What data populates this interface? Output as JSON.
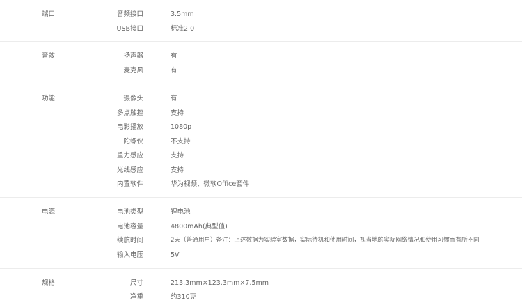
{
  "sections": [
    {
      "title": "端口",
      "rows": [
        {
          "label": "音频接口",
          "value": "3.5mm"
        },
        {
          "label": "USB接口",
          "value": "标准2.0"
        }
      ]
    },
    {
      "title": "音效",
      "rows": [
        {
          "label": "扬声器",
          "value": "有"
        },
        {
          "label": "麦克风",
          "value": "有"
        }
      ]
    },
    {
      "title": "功能",
      "rows": [
        {
          "label": "摄像头",
          "value": "有"
        },
        {
          "label": "多点触控",
          "value": "支持"
        },
        {
          "label": "电影播放",
          "value": "1080p"
        },
        {
          "label": "陀螺仪",
          "value": "不支持"
        },
        {
          "label": "重力感应",
          "value": "支持"
        },
        {
          "label": "光线感应",
          "value": "支持"
        },
        {
          "label": "内置软件",
          "value": "华为视频、微软Office套件"
        }
      ]
    },
    {
      "title": "电源",
      "rows": [
        {
          "label": "电池类型",
          "value": "锂电池"
        },
        {
          "label": "电池容量",
          "value": "4800mAh(典型值)"
        },
        {
          "label": "续航时间",
          "value": "2天（普通用户）备注：上述数据为实验室数据，实际待机和使用时间，视当地的实际网络情况和使用习惯而有所不同"
        },
        {
          "label": "输入电压",
          "value": "5V"
        }
      ]
    },
    {
      "title": "规格",
      "rows": [
        {
          "label": "尺寸",
          "value": "213.3mm×123.3mm×7.5mm"
        },
        {
          "label": "净重",
          "value": "约310克"
        }
      ]
    }
  ]
}
